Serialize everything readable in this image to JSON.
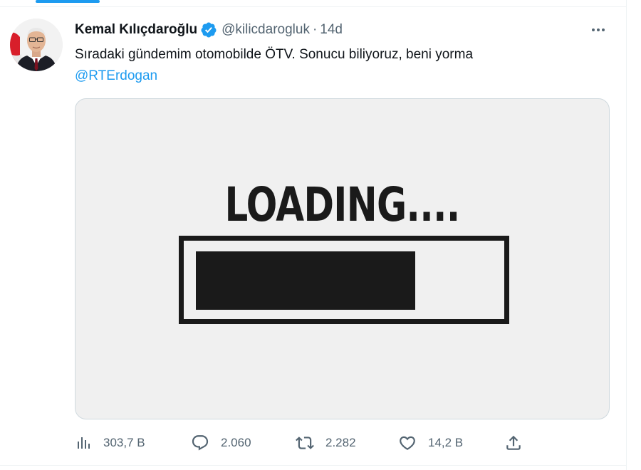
{
  "tweet": {
    "author": {
      "name": "Kemal Kılıçdaroğlu",
      "handle": "@kilicdarogluk",
      "verified": true
    },
    "separator": "·",
    "time": "14d",
    "text": "Sıradaki gündemim otomobilde ÖTV. Sonucu biliyoruz, beni yorma",
    "mention": "@RTErdogan",
    "media": {
      "caption": "LOADING....",
      "progress_fraction": 0.74
    },
    "stats": {
      "views": "303,7 B",
      "replies": "2.060",
      "retweets": "2.282",
      "likes": "14,2 B"
    }
  },
  "icons": {
    "verified": "verified-badge-icon",
    "more": "more-dots-icon",
    "views": "analytics-bars-icon",
    "reply": "speech-bubble-icon",
    "retweet": "retweet-arrows-icon",
    "like": "heart-icon",
    "share": "share-upload-icon"
  },
  "colors": {
    "accent": "#1d9bf0",
    "text": "#0f1419",
    "secondary": "#536471",
    "media_bg": "#f0f0f0",
    "loading_ink": "#1a1a1a"
  }
}
